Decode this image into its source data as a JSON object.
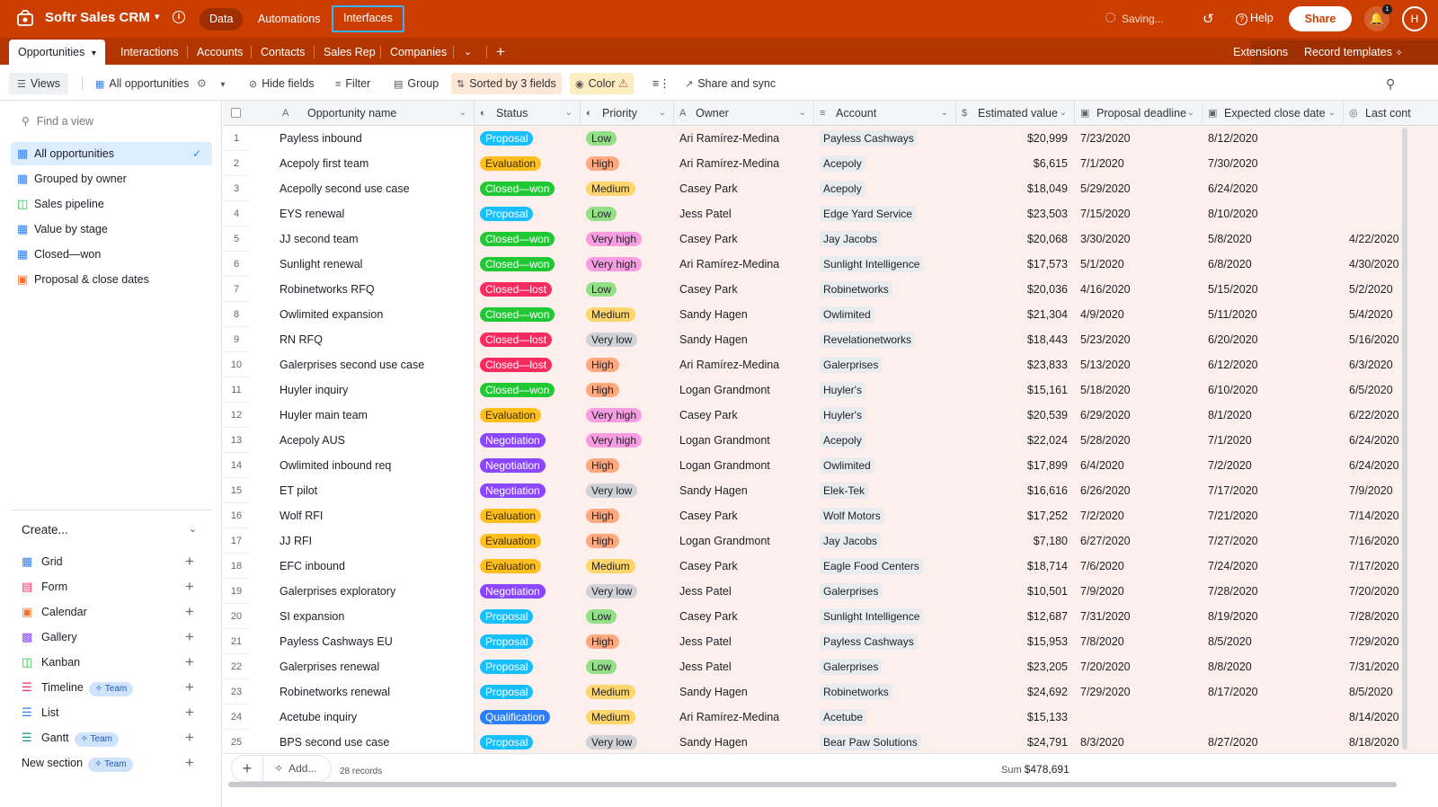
{
  "app": {
    "title": "Softr Sales CRM",
    "tabs": [
      "Data",
      "Automations",
      "Interfaces"
    ],
    "saving": "Saving...",
    "help": "Help",
    "share": "Share",
    "notifications": "1",
    "avatar": "H"
  },
  "tables": {
    "items": [
      "Opportunities",
      "Interactions",
      "Accounts",
      "Contacts",
      "Sales Rep",
      "Companies"
    ],
    "extensions": "Extensions",
    "record_templates": "Record templates"
  },
  "toolbar": {
    "views": "Views",
    "view_name": "All opportunities",
    "hide_fields": "Hide fields",
    "filter": "Filter",
    "group": "Group",
    "sorted": "Sorted by 3 fields",
    "color": "Color",
    "share_sync": "Share and sync"
  },
  "sidebar": {
    "find_placeholder": "Find a view",
    "views": [
      {
        "label": "All opportunities",
        "icon": "grid-icon",
        "selected": true
      },
      {
        "label": "Grouped by owner",
        "icon": "grid-icon"
      },
      {
        "label": "Sales pipeline",
        "icon": "kanban-icon"
      },
      {
        "label": "Value by stage",
        "icon": "grid-icon"
      },
      {
        "label": "Closed—won",
        "icon": "grid-icon"
      },
      {
        "label": "Proposal & close dates",
        "icon": "calendar-icon"
      }
    ],
    "create_title": "Create...",
    "create_items": [
      {
        "label": "Grid",
        "icon": "grid-icon"
      },
      {
        "label": "Form",
        "icon": "form-icon"
      },
      {
        "label": "Calendar",
        "icon": "calendar-icon"
      },
      {
        "label": "Gallery",
        "icon": "gallery-icon"
      },
      {
        "label": "Kanban",
        "icon": "kanban-icon"
      },
      {
        "label": "Timeline",
        "icon": "timeline-icon",
        "badge": "Team"
      },
      {
        "label": "List",
        "icon": "list-icon"
      },
      {
        "label": "Gantt",
        "icon": "gantt-icon",
        "badge": "Team"
      },
      {
        "label": "New section",
        "icon": "",
        "badge": "Team"
      }
    ]
  },
  "grid": {
    "columns": [
      "Opportunity name",
      "Status",
      "Priority",
      "Owner",
      "Account",
      "Estimated value",
      "Proposal deadline",
      "Expected close date",
      "Last cont"
    ],
    "rows": [
      {
        "n": "1",
        "name": "Payless inbound",
        "status": "Proposal",
        "priority": "Low",
        "owner": "Ari Ramírez-Medina",
        "account": "Payless Cashways",
        "value": "$20,999",
        "proposal": "7/23/2020",
        "close": "8/12/2020",
        "last": ""
      },
      {
        "n": "2",
        "name": "Acepoly first team",
        "status": "Evaluation",
        "priority": "High",
        "owner": "Ari Ramírez-Medina",
        "account": "Acepoly",
        "value": "$6,615",
        "proposal": "7/1/2020",
        "close": "7/30/2020",
        "last": ""
      },
      {
        "n": "3",
        "name": "Acepolly second use case",
        "status": "Closed—won",
        "priority": "Medium",
        "owner": "Casey Park",
        "account": "Acepoly",
        "value": "$18,049",
        "proposal": "5/29/2020",
        "close": "6/24/2020",
        "last": ""
      },
      {
        "n": "4",
        "name": "EYS renewal",
        "status": "Proposal",
        "priority": "Low",
        "owner": "Jess Patel",
        "account": "Edge Yard Service",
        "value": "$23,503",
        "proposal": "7/15/2020",
        "close": "8/10/2020",
        "last": ""
      },
      {
        "n": "5",
        "name": "JJ second team",
        "status": "Closed—won",
        "priority": "Very high",
        "owner": "Casey Park",
        "account": "Jay Jacobs",
        "value": "$20,068",
        "proposal": "3/30/2020",
        "close": "5/8/2020",
        "last": "4/22/2020"
      },
      {
        "n": "6",
        "name": "Sunlight renewal",
        "status": "Closed—won",
        "priority": "Very high",
        "owner": "Ari Ramírez-Medina",
        "account": "Sunlight Intelligence",
        "value": "$17,573",
        "proposal": "5/1/2020",
        "close": "6/8/2020",
        "last": "4/30/2020"
      },
      {
        "n": "7",
        "name": "Robinetworks RFQ",
        "status": "Closed—lost",
        "priority": "Low",
        "owner": "Casey Park",
        "account": "Robinetworks",
        "value": "$20,036",
        "proposal": "4/16/2020",
        "close": "5/15/2020",
        "last": "5/2/2020"
      },
      {
        "n": "8",
        "name": "Owlimited expansion",
        "status": "Closed—won",
        "priority": "Medium",
        "owner": "Sandy Hagen",
        "account": "Owlimited",
        "value": "$21,304",
        "proposal": "4/9/2020",
        "close": "5/11/2020",
        "last": "5/4/2020"
      },
      {
        "n": "9",
        "name": "RN RFQ",
        "status": "Closed—lost",
        "priority": "Very low",
        "owner": "Sandy Hagen",
        "account": "Revelationetworks",
        "value": "$18,443",
        "proposal": "5/23/2020",
        "close": "6/20/2020",
        "last": "5/16/2020"
      },
      {
        "n": "10",
        "name": "Galerprises second use case",
        "status": "Closed—lost",
        "priority": "High",
        "owner": "Ari Ramírez-Medina",
        "account": "Galerprises",
        "value": "$23,833",
        "proposal": "5/13/2020",
        "close": "6/12/2020",
        "last": "6/3/2020"
      },
      {
        "n": "11",
        "name": "Huyler inquiry",
        "status": "Closed—won",
        "priority": "High",
        "owner": "Logan Grandmont",
        "account": "Huyler's",
        "value": "$15,161",
        "proposal": "5/18/2020",
        "close": "6/10/2020",
        "last": "6/5/2020"
      },
      {
        "n": "12",
        "name": "Huyler main team",
        "status": "Evaluation",
        "priority": "Very high",
        "owner": "Casey Park",
        "account": "Huyler's",
        "value": "$20,539",
        "proposal": "6/29/2020",
        "close": "8/1/2020",
        "last": "6/22/2020"
      },
      {
        "n": "13",
        "name": "Acepoly AUS",
        "status": "Negotiation",
        "priority": "Very high",
        "owner": "Logan Grandmont",
        "account": "Acepoly",
        "value": "$22,024",
        "proposal": "5/28/2020",
        "close": "7/1/2020",
        "last": "6/24/2020"
      },
      {
        "n": "14",
        "name": "Owlimited inbound req",
        "status": "Negotiation",
        "priority": "High",
        "owner": "Logan Grandmont",
        "account": "Owlimited",
        "value": "$17,899",
        "proposal": "6/4/2020",
        "close": "7/2/2020",
        "last": "6/24/2020"
      },
      {
        "n": "15",
        "name": "ET pilot",
        "status": "Negotiation",
        "priority": "Very low",
        "owner": "Sandy Hagen",
        "account": "Elek-Tek",
        "value": "$16,616",
        "proposal": "6/26/2020",
        "close": "7/17/2020",
        "last": "7/9/2020"
      },
      {
        "n": "16",
        "name": "Wolf RFI",
        "status": "Evaluation",
        "priority": "High",
        "owner": "Casey Park",
        "account": "Wolf Motors",
        "value": "$17,252",
        "proposal": "7/2/2020",
        "close": "7/21/2020",
        "last": "7/14/2020"
      },
      {
        "n": "17",
        "name": "JJ RFI",
        "status": "Evaluation",
        "priority": "High",
        "owner": "Logan Grandmont",
        "account": "Jay Jacobs",
        "value": "$7,180",
        "proposal": "6/27/2020",
        "close": "7/27/2020",
        "last": "7/16/2020"
      },
      {
        "n": "18",
        "name": "EFC inbound",
        "status": "Evaluation",
        "priority": "Medium",
        "owner": "Casey Park",
        "account": "Eagle Food Centers",
        "value": "$18,714",
        "proposal": "7/6/2020",
        "close": "7/24/2020",
        "last": "7/17/2020"
      },
      {
        "n": "19",
        "name": "Galerprises exploratory",
        "status": "Negotiation",
        "priority": "Very low",
        "owner": "Jess Patel",
        "account": "Galerprises",
        "value": "$10,501",
        "proposal": "7/9/2020",
        "close": "7/28/2020",
        "last": "7/20/2020"
      },
      {
        "n": "20",
        "name": "SI expansion",
        "status": "Proposal",
        "priority": "Low",
        "owner": "Casey Park",
        "account": "Sunlight Intelligence",
        "value": "$12,687",
        "proposal": "7/31/2020",
        "close": "8/19/2020",
        "last": "7/28/2020"
      },
      {
        "n": "21",
        "name": "Payless Cashways EU",
        "status": "Proposal",
        "priority": "High",
        "owner": "Jess Patel",
        "account": "Payless Cashways",
        "value": "$15,953",
        "proposal": "7/8/2020",
        "close": "8/5/2020",
        "last": "7/29/2020"
      },
      {
        "n": "22",
        "name": "Galerprises renewal",
        "status": "Proposal",
        "priority": "Low",
        "owner": "Jess Patel",
        "account": "Galerprises",
        "value": "$23,205",
        "proposal": "7/20/2020",
        "close": "8/8/2020",
        "last": "7/31/2020"
      },
      {
        "n": "23",
        "name": "Robinetworks renewal",
        "status": "Proposal",
        "priority": "Medium",
        "owner": "Sandy Hagen",
        "account": "Robinetworks",
        "value": "$24,692",
        "proposal": "7/29/2020",
        "close": "8/17/2020",
        "last": "8/5/2020"
      },
      {
        "n": "24",
        "name": "Acetube inquiry",
        "status": "Qualification",
        "priority": "Medium",
        "owner": "Ari Ramírez-Medina",
        "account": "Acetube",
        "value": "$15,133",
        "proposal": "",
        "close": "",
        "last": "8/14/2020"
      },
      {
        "n": "25",
        "name": "BPS second use case",
        "status": "Proposal",
        "priority": "Very low",
        "owner": "Sandy Hagen",
        "account": "Bear Paw Solutions",
        "value": "$24,791",
        "proposal": "8/3/2020",
        "close": "8/27/2020",
        "last": "8/18/2020"
      }
    ],
    "add_label": "Add...",
    "records": "28 records",
    "sum_label": "Sum",
    "sum_value": "$478,691"
  },
  "colors": {
    "brand": "#cc3d00",
    "status": {
      "Proposal": "#18bfff",
      "Evaluation": "#ffc01e",
      "Closed—won": "#20c933",
      "Closed—lost": "#f82b60",
      "Negotiation": "#8b46ff",
      "Qualification": "#2d7ff9"
    },
    "priority": {
      "Low": "#93e088",
      "High": "#ffa981",
      "Medium": "#ffd66e",
      "Very high": "#f99de2",
      "Very low": "#d0d2d8"
    }
  }
}
